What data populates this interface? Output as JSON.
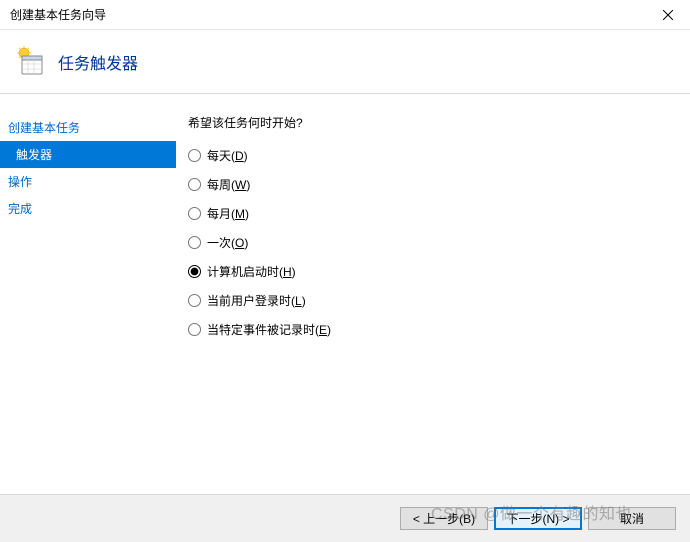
{
  "window": {
    "title": "创建基本任务向导"
  },
  "header": {
    "title": "任务触发器"
  },
  "sidebar": {
    "items": [
      {
        "label": "创建基本任务",
        "active": false,
        "indent": false
      },
      {
        "label": "触发器",
        "active": true,
        "indent": true
      },
      {
        "label": "操作",
        "active": false,
        "indent": false
      },
      {
        "label": "完成",
        "active": false,
        "indent": false
      }
    ]
  },
  "main": {
    "prompt": "希望该任务何时开始?",
    "radios": [
      {
        "label": "每天",
        "accel": "D",
        "checked": false
      },
      {
        "label": "每周",
        "accel": "W",
        "checked": false
      },
      {
        "label": "每月",
        "accel": "M",
        "checked": false
      },
      {
        "label": "一次",
        "accel": "O",
        "checked": false
      },
      {
        "label": "计算机启动时",
        "accel": "H",
        "checked": true
      },
      {
        "label": "当前用户登录时",
        "accel": "L",
        "checked": false
      },
      {
        "label": "当特定事件被记录时",
        "accel": "E",
        "checked": false
      }
    ]
  },
  "footer": {
    "back": "< 上一步(B)",
    "next": "下一步(N) >",
    "cancel": "取消"
  },
  "watermark": "CSDN @做一个有趣的知也"
}
